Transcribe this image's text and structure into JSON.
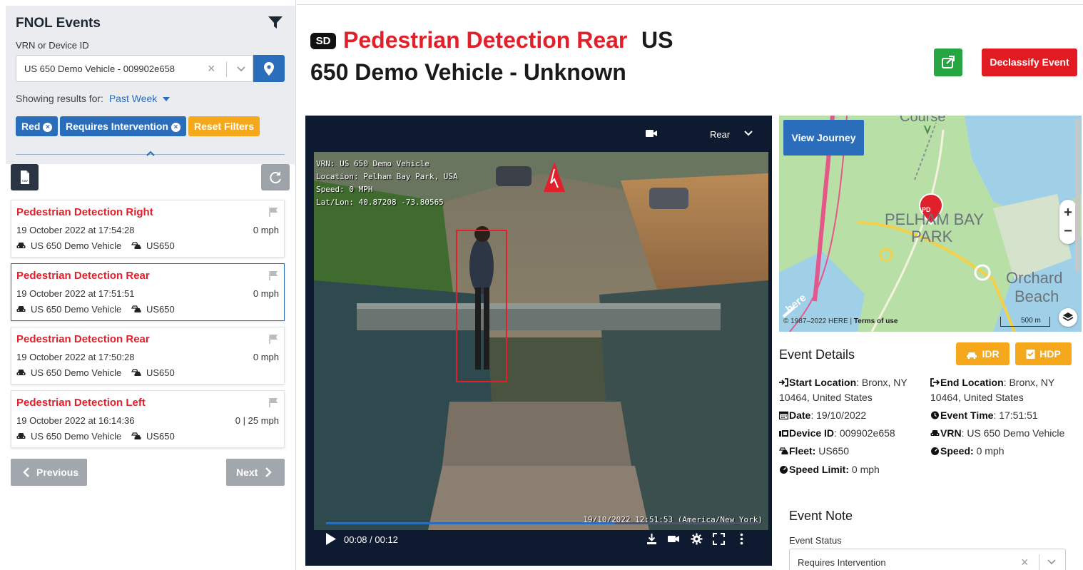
{
  "sidebar": {
    "title": "FNOL Events",
    "vrn_label": "VRN or Device ID",
    "vrn_value": "US 650 Demo Vehicle - 009902e658",
    "showing_label": "Showing results for:",
    "showing_value": "Past Week",
    "chips": [
      {
        "label": "Red",
        "color": "#2a6ebb"
      },
      {
        "label": "Requires Intervention",
        "color": "#2a6ebb"
      },
      {
        "label": "Reset Filters",
        "color": "#f5a81c"
      }
    ],
    "events": [
      {
        "title": "Pedestrian Detection Right",
        "time": "19 October 2022 at 17:54:28",
        "speed": "0 mph",
        "vehicle": "US 650 Demo Vehicle",
        "fleet": "US650"
      },
      {
        "title": "Pedestrian Detection Rear",
        "time": "19 October 2022 at 17:51:51",
        "speed": "0 mph",
        "vehicle": "US 650 Demo Vehicle",
        "fleet": "US650"
      },
      {
        "title": "Pedestrian Detection Rear",
        "time": "19 October 2022 at 17:50:28",
        "speed": "0 mph",
        "vehicle": "US 650 Demo Vehicle",
        "fleet": "US650"
      },
      {
        "title": "Pedestrian Detection Left",
        "time": "19 October 2022 at 16:14:36",
        "speed": "0 | 25 mph",
        "vehicle": "US 650 Demo Vehicle",
        "fleet": "US650"
      }
    ],
    "selected_index": 1,
    "prev_label": "Previous",
    "next_label": "Next"
  },
  "header": {
    "badge": "SD",
    "title_red": "Pedestrian Detection Rear",
    "title_black_1": "US",
    "title_black_2": "650 Demo Vehicle - Unknown",
    "declassify_label": "Declassify Event"
  },
  "video": {
    "camera": "Rear",
    "overlay_lines": [
      "VRN: US 650 Demo Vehicle",
      "Location: Pelham Bay Park, USA",
      "Speed: 0 MPH",
      "Lat/Lon: 40.87208 -73.80565"
    ],
    "timestamp": "19/10/2022 12:51:53 (America/New_York)",
    "time_display": "00:08 / 00:12",
    "progress": 0.6667
  },
  "map": {
    "view_journey_label": "View Journey",
    "place_label_1": "PELHAM BAY",
    "place_label_2": "PARK",
    "place_label_3": "Orchard",
    "place_label_4": "Beach",
    "place_label_5": "Course",
    "marker_label": "PD",
    "zoom_in": "+",
    "zoom_out": "−",
    "copyright": "© 1987–2022 HERE |",
    "terms": "Terms of use",
    "scale": "500 m",
    "logo": "here"
  },
  "details": {
    "title": "Event Details",
    "idr_label": "IDR",
    "hdp_label": "HDP",
    "start_location_label": "Start Location",
    "start_location_value": ": Bronx, NY",
    "start_location_value2": "10464, United States",
    "end_location_label": "End Location",
    "end_location_value": ": Bronx, NY",
    "end_location_value2": "10464, United States",
    "date_label": "Date",
    "date_value": ": 19/10/2022",
    "event_time_label": "Event Time",
    "event_time_value": ": 17:51:51",
    "device_id_label": "Device ID",
    "device_id_value": ": 009902e658",
    "vrn_label": "VRN",
    "vrn_value": ": US 650 Demo Vehicle",
    "fleet_label": "Fleet:",
    "fleet_value": " US650",
    "speed_label": "Speed:",
    "speed_value": " 0 mph",
    "speed_limit_label": "Speed Limit:",
    "speed_limit_value": " 0 mph"
  },
  "note": {
    "title": "Event Note",
    "status_label": "Event Status",
    "status_value": "Requires Intervention"
  }
}
